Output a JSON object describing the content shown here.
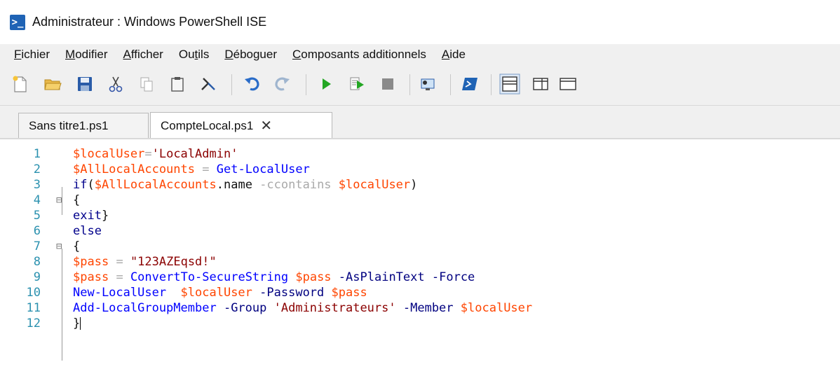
{
  "window": {
    "title": "Administrateur : Windows PowerShell ISE",
    "icon": "powershell-ise-icon"
  },
  "menu": {
    "items": [
      {
        "label": "Fichier",
        "accel": "F"
      },
      {
        "label": "Modifier",
        "accel": "M"
      },
      {
        "label": "Afficher",
        "accel": "A"
      },
      {
        "label": "Outils",
        "accel": "t"
      },
      {
        "label": "Déboguer",
        "accel": "D"
      },
      {
        "label": "Composants additionnels",
        "accel": "C"
      },
      {
        "label": "Aide",
        "accel": "A"
      }
    ]
  },
  "toolbar": {
    "buttons": [
      "new-file-icon",
      "open-folder-icon",
      "save-icon",
      "cut-icon",
      "copy-icon",
      "paste-icon",
      "clear-console-icon",
      "undo-icon",
      "redo-icon",
      "run-icon",
      "run-selection-icon",
      "stop-icon",
      "remote-powershell-icon",
      "powershell-console-icon",
      "layout-top-icon",
      "layout-right-icon",
      "layout-max-icon"
    ]
  },
  "tabs": [
    {
      "label": "Sans titre1.ps1",
      "active": false
    },
    {
      "label": "CompteLocal.ps1",
      "active": true,
      "close": "✕"
    }
  ],
  "editor": {
    "lines": [
      {
        "n": "1",
        "tokens": [
          [
            "var",
            "$localUser"
          ],
          [
            "op",
            "="
          ],
          [
            "str",
            "'LocalAdmin'"
          ]
        ]
      },
      {
        "n": "2",
        "tokens": [
          [
            "var",
            "$AllLocalAccounts"
          ],
          [
            "plain",
            " "
          ],
          [
            "op",
            "="
          ],
          [
            "plain",
            " "
          ],
          [
            "cmd",
            "Get-LocalUser"
          ]
        ]
      },
      {
        "n": "3",
        "tokens": [
          [
            "kw",
            "if"
          ],
          [
            "plain",
            "("
          ],
          [
            "var",
            "$AllLocalAccounts"
          ],
          [
            "plain",
            "."
          ],
          [
            "member",
            "name"
          ],
          [
            "plain",
            " "
          ],
          [
            "op",
            "-ccontains"
          ],
          [
            "plain",
            " "
          ],
          [
            "var",
            "$localUser"
          ],
          [
            "plain",
            ")"
          ]
        ]
      },
      {
        "n": "4",
        "tokens": [
          [
            "plain",
            "{"
          ]
        ]
      },
      {
        "n": "5",
        "tokens": [
          [
            "kw",
            "exit"
          ],
          [
            "plain",
            "}"
          ]
        ]
      },
      {
        "n": "6",
        "tokens": [
          [
            "kw",
            "else"
          ]
        ]
      },
      {
        "n": "7",
        "tokens": [
          [
            "plain",
            "{"
          ]
        ]
      },
      {
        "n": "8",
        "tokens": [
          [
            "var",
            "$pass"
          ],
          [
            "plain",
            " "
          ],
          [
            "op",
            "="
          ],
          [
            "plain",
            " "
          ],
          [
            "str",
            "\"123AZEqsd!\""
          ]
        ]
      },
      {
        "n": "9",
        "tokens": [
          [
            "var",
            "$pass"
          ],
          [
            "plain",
            " "
          ],
          [
            "op",
            "="
          ],
          [
            "plain",
            " "
          ],
          [
            "cmd",
            "ConvertTo-SecureString"
          ],
          [
            "plain",
            " "
          ],
          [
            "var",
            "$pass"
          ],
          [
            "plain",
            " "
          ],
          [
            "prm",
            "-AsPlainText"
          ],
          [
            "plain",
            " "
          ],
          [
            "prm",
            "-Force"
          ]
        ]
      },
      {
        "n": "10",
        "tokens": [
          [
            "cmd",
            "New-LocalUser"
          ],
          [
            "plain",
            "  "
          ],
          [
            "var",
            "$localUser"
          ],
          [
            "plain",
            " "
          ],
          [
            "prm",
            "-Password"
          ],
          [
            "plain",
            " "
          ],
          [
            "var",
            "$pass"
          ]
        ]
      },
      {
        "n": "11",
        "tokens": [
          [
            "cmd",
            "Add-LocalGroupMember"
          ],
          [
            "plain",
            " "
          ],
          [
            "prm",
            "-Group"
          ],
          [
            "plain",
            " "
          ],
          [
            "str",
            "'Administrateurs'"
          ],
          [
            "plain",
            " "
          ],
          [
            "prm",
            "-Member"
          ],
          [
            "plain",
            " "
          ],
          [
            "var",
            "$localUser"
          ]
        ]
      },
      {
        "n": "12",
        "tokens": [
          [
            "plain",
            "}"
          ]
        ]
      }
    ],
    "colors": {
      "variable": "#ff4500",
      "keyword": "#00008b",
      "command": "#0000ff",
      "string": "#8b0000",
      "operator": "#a9a9a9",
      "parameter": "#000080",
      "line_number": "#2b91af"
    }
  }
}
